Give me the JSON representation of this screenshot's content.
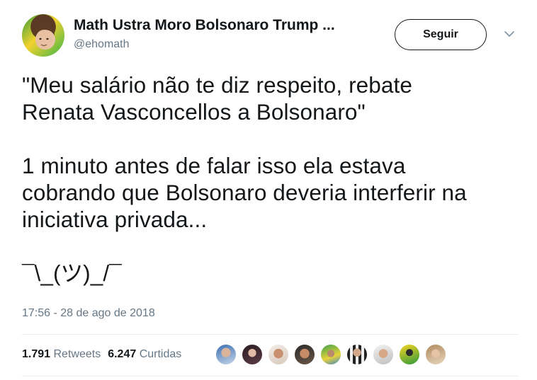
{
  "author": {
    "name": "Math Ustra Moro Bolsonaro Trump ...",
    "handle": "@ehomath"
  },
  "follow_button": {
    "label": "Seguir"
  },
  "tweet": {
    "text": "\"Meu salário não te diz respeito, rebate\nRenata Vasconcellos a Bolsonaro\"\n\n1 minuto antes de falar isso ela estava\ncobrando que Bolsonaro deveria interferir na\niniciativa privada...\n\n¯\\_(ツ)_/¯",
    "timestamp": "17:56 - 28 de ago de 2018"
  },
  "stats": {
    "retweets_count": "1.791",
    "retweets_label": "Retweets",
    "likes_count": "6.247",
    "likes_label": "Curtidas"
  },
  "colors": {
    "text": "#14171a",
    "secondary_text": "#657786",
    "divider": "#e6ecf0"
  },
  "icons": {
    "menu": "chevron-down-icon"
  }
}
